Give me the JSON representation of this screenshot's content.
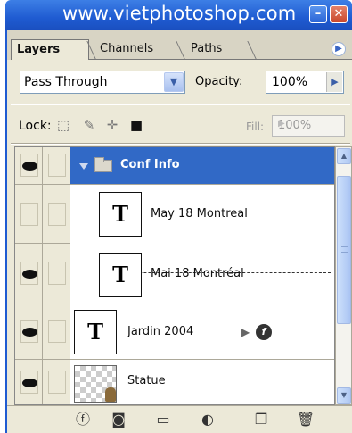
{
  "window": {
    "title": "www.vietphotoshop.com"
  },
  "tabs": [
    {
      "label": "Layers",
      "active": true
    },
    {
      "label": "Channels",
      "active": false
    },
    {
      "label": "Paths",
      "active": false
    }
  ],
  "options": {
    "blend_mode": "Pass Through",
    "opacity_label": "Opacity:",
    "opacity_value": "100%",
    "lock_label": "Lock:",
    "fill_label": "Fill:",
    "fill_value": "100%"
  },
  "layers": [
    {
      "name": "Conf Info",
      "type": "group",
      "visible": true,
      "selected": true
    },
    {
      "name": "May 18 Montreal",
      "type": "text",
      "visible": false
    },
    {
      "name": "Mai 18 Montréal",
      "type": "text",
      "visible": true
    },
    {
      "name": "Jardin 2004",
      "type": "text",
      "visible": true,
      "has_effects": true
    },
    {
      "name": "Statue",
      "type": "image",
      "visible": true
    }
  ],
  "thumb_letter": "T",
  "colors": {
    "title_bar": "#1f5bd1",
    "selection": "#3169c6",
    "panel": "#ece9d8"
  }
}
